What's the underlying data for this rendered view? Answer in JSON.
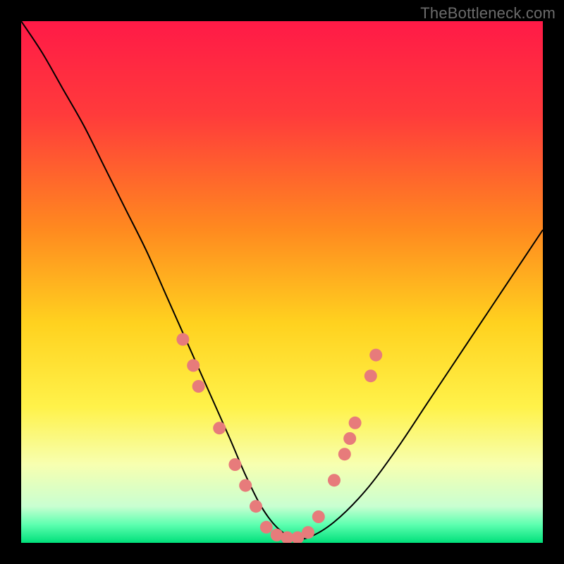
{
  "watermark": {
    "text": "TheBottleneck.com"
  },
  "chart_data": {
    "type": "line",
    "title": "",
    "xlabel": "",
    "ylabel": "",
    "xlim": [
      0,
      100
    ],
    "ylim": [
      0,
      100
    ],
    "grid": false,
    "legend": false,
    "background_gradient_stops": [
      {
        "offset": 0,
        "color": "#ff1a47"
      },
      {
        "offset": 0.18,
        "color": "#ff3b3b"
      },
      {
        "offset": 0.4,
        "color": "#ff8a1f"
      },
      {
        "offset": 0.58,
        "color": "#ffd21f"
      },
      {
        "offset": 0.74,
        "color": "#fff24a"
      },
      {
        "offset": 0.85,
        "color": "#f7ffb0"
      },
      {
        "offset": 0.93,
        "color": "#c9ffd1"
      },
      {
        "offset": 0.965,
        "color": "#5dffb0"
      },
      {
        "offset": 1.0,
        "color": "#00e07a"
      }
    ],
    "series": [
      {
        "name": "bottleneck-curve",
        "color": "#000000",
        "stroke_width": 2,
        "x": [
          0,
          4,
          8,
          12,
          16,
          20,
          24,
          28,
          32,
          36,
          40,
          43,
          46,
          49,
          52,
          55,
          60,
          66,
          72,
          78,
          84,
          90,
          96,
          100
        ],
        "y": [
          100,
          94,
          87,
          80,
          72,
          64,
          56,
          47,
          38,
          29,
          20,
          13,
          7,
          3,
          1,
          1,
          4,
          10,
          18,
          27,
          36,
          45,
          54,
          60
        ]
      }
    ],
    "markers": {
      "color": "#e77b7b",
      "radius": 9,
      "points": [
        {
          "x": 31,
          "y": 39
        },
        {
          "x": 33,
          "y": 34
        },
        {
          "x": 34,
          "y": 30
        },
        {
          "x": 38,
          "y": 22
        },
        {
          "x": 41,
          "y": 15
        },
        {
          "x": 43,
          "y": 11
        },
        {
          "x": 45,
          "y": 7
        },
        {
          "x": 47,
          "y": 3
        },
        {
          "x": 49,
          "y": 1.5
        },
        {
          "x": 51,
          "y": 1
        },
        {
          "x": 53,
          "y": 1
        },
        {
          "x": 55,
          "y": 2
        },
        {
          "x": 57,
          "y": 5
        },
        {
          "x": 60,
          "y": 12
        },
        {
          "x": 62,
          "y": 17
        },
        {
          "x": 63,
          "y": 20
        },
        {
          "x": 64,
          "y": 23
        },
        {
          "x": 67,
          "y": 32
        },
        {
          "x": 68,
          "y": 36
        }
      ]
    }
  }
}
